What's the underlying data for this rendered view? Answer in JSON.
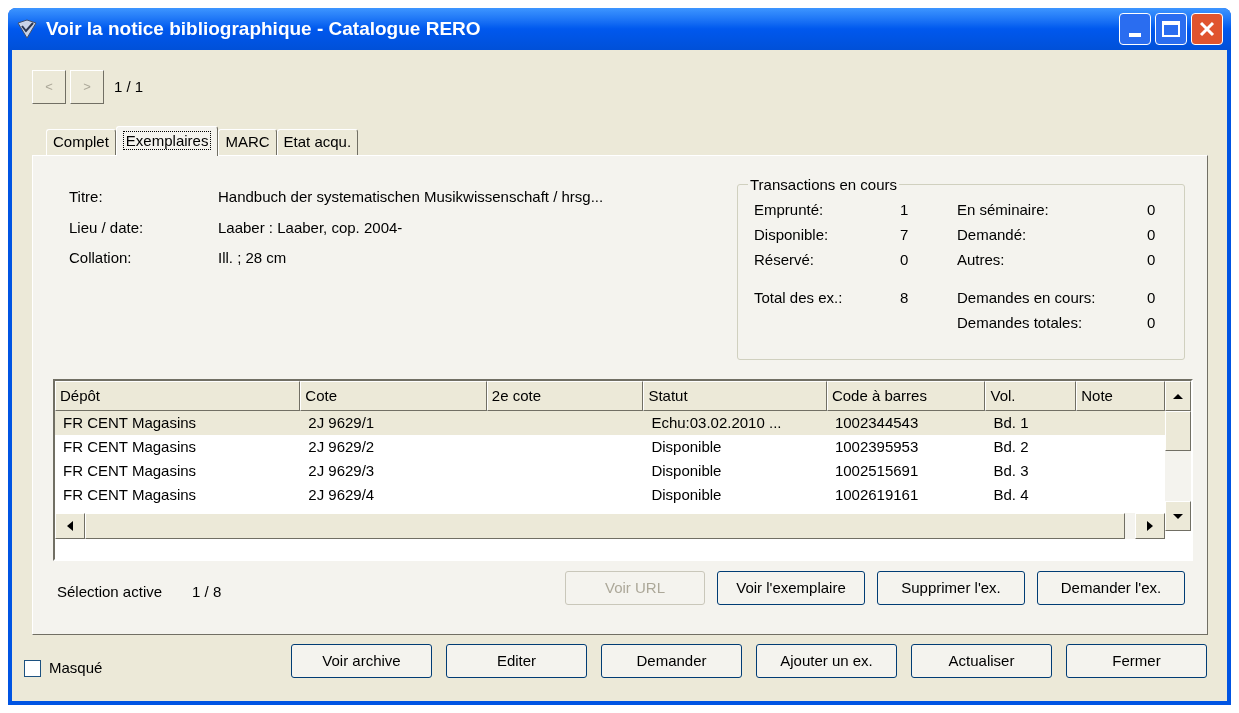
{
  "window": {
    "title": "Voir la notice bibliographique - Catalogue RERO"
  },
  "nav": {
    "buttons": [
      {
        "label": "<",
        "disabled": true
      },
      {
        "label": ">",
        "disabled": true
      }
    ],
    "position": "1 / 1"
  },
  "tabs": [
    {
      "label": "Complet",
      "selected": false
    },
    {
      "label": "Exemplaires",
      "selected": true
    },
    {
      "label": "MARC",
      "selected": false
    },
    {
      "label": "Etat acqu.",
      "selected": false
    }
  ],
  "info": [
    {
      "label": "Titre:",
      "value": "Handbuch der systematischen Musikwissenschaft / hrsg..."
    },
    {
      "label": "Lieu / date:",
      "value": "Laaber : Laaber, cop. 2004-"
    },
    {
      "label": "Collation:",
      "value": "Ill. ; 28 cm"
    }
  ],
  "transactions": {
    "title": "Transactions en cours",
    "groups": [
      [
        {
          "left": {
            "label": "Emprunté:",
            "value": "1"
          },
          "right": {
            "label": "En séminaire:",
            "value": "0"
          }
        },
        {
          "left": {
            "label": "Disponible:",
            "value": "7"
          },
          "right": {
            "label": "Demandé:",
            "value": "0"
          }
        },
        {
          "left": {
            "label": "Réservé:",
            "value": "0"
          },
          "right": {
            "label": "Autres:",
            "value": "0"
          }
        }
      ],
      [
        {
          "left": {
            "label": "Total des ex.:",
            "value": "8"
          },
          "right": {
            "label": "Demandes en cours:",
            "value": "0"
          }
        },
        {
          "right": {
            "label": "Demandes totales:",
            "value": "0"
          }
        }
      ]
    ]
  },
  "table": {
    "columns": [
      "Dépôt",
      "Cote",
      "2e cote",
      "Statut",
      "Code à barres",
      "Vol.",
      "Note"
    ],
    "rows": [
      {
        "selected": true,
        "cells": [
          "FR CENT Magasins",
          "2J 9629/1",
          "",
          "Echu:03.02.2010 ...",
          "1002344543",
          "Bd. 1",
          ""
        ]
      },
      {
        "selected": false,
        "cells": [
          "FR CENT Magasins",
          "2J 9629/2",
          "",
          "Disponible",
          "1002395953",
          "Bd. 2",
          ""
        ]
      },
      {
        "selected": false,
        "cells": [
          "FR CENT Magasins",
          "2J 9629/3",
          "",
          "Disponible",
          "1002515691",
          "Bd. 3",
          ""
        ]
      },
      {
        "selected": false,
        "cells": [
          "FR CENT Magasins",
          "2J 9629/4",
          "",
          "Disponible",
          "1002619161",
          "Bd. 4",
          ""
        ]
      }
    ]
  },
  "selection": {
    "label": "Sélection active",
    "value": "1 / 8"
  },
  "item_buttons": [
    {
      "label": "Voir URL",
      "disabled": true
    },
    {
      "label": "Voir l'exemplaire",
      "disabled": false
    },
    {
      "label": "Supprimer l'ex.",
      "disabled": false
    },
    {
      "label": "Demander l'ex.",
      "disabled": false
    }
  ],
  "masked": {
    "label": "Masqué",
    "checked": false
  },
  "footer_buttons": [
    {
      "label": "Voir archive"
    },
    {
      "label": "Editer"
    },
    {
      "label": "Demander"
    },
    {
      "label": "Ajouter un ex."
    },
    {
      "label": "Actualiser"
    },
    {
      "label": "Fermer"
    }
  ]
}
